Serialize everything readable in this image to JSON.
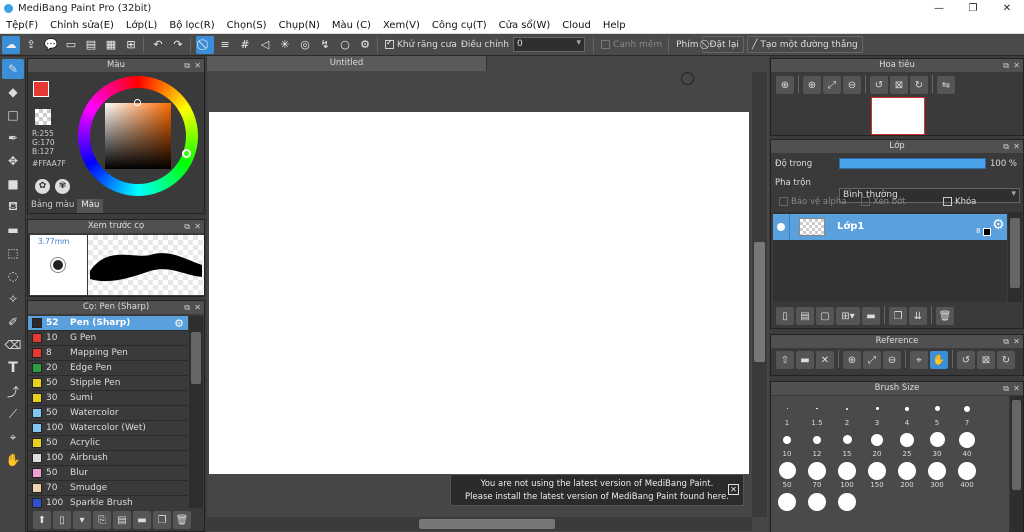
{
  "app": {
    "title": "MediBang Paint Pro (32bit)",
    "minimize": "—",
    "maximize": "❐",
    "close": "✕"
  },
  "menu": [
    "Tệp(F)",
    "Chỉnh sửa(E)",
    "Lớp(L)",
    "Bộ lọc(R)",
    "Chọn(S)",
    "Chụp(N)",
    "Màu (C)",
    "Xem(V)",
    "Công cụ(T)",
    "Cửa sổ(W)",
    "Cloud",
    "Help"
  ],
  "toolbar": {
    "antialias_label": "Khử răng cưa",
    "adjust_label": "Điều chỉnh",
    "adjust_value": "0",
    "edge_label": "Cạnh mềm",
    "keys_label": "Phím",
    "reset_label": "Đặt lại",
    "straight_line_label": "Tạo một đường thẳng"
  },
  "color_panel": {
    "title": "Màu",
    "r": "R:255",
    "g": "G:170",
    "b": "B:127",
    "hex": "#FFAA7F",
    "tab_palette": "Bảng màu",
    "tab_color": "Màu",
    "primary_color": "#FFAA7F",
    "accent_red": "#e53935"
  },
  "brush_preview": {
    "title": "Xem trước cọ",
    "size": "3.77mm"
  },
  "brush_panel": {
    "title": "Cọ: Pen (Sharp)",
    "items": [
      {
        "size": "52",
        "name": "Pen (Sharp)",
        "color": "#2a2a2a"
      },
      {
        "size": "10",
        "name": "G Pen",
        "color": "#e53935"
      },
      {
        "size": "8",
        "name": "Mapping Pen",
        "color": "#e53935"
      },
      {
        "size": "20",
        "name": "Edge Pen",
        "color": "#2e9e3e"
      },
      {
        "size": "50",
        "name": "Stipple Pen",
        "color": "#e8d020"
      },
      {
        "size": "30",
        "name": "Sumi",
        "color": "#e8d020"
      },
      {
        "size": "50",
        "name": "Watercolor",
        "color": "#7ec8f0"
      },
      {
        "size": "100",
        "name": "Watercolor (Wet)",
        "color": "#7ec8f0"
      },
      {
        "size": "50",
        "name": "Acrylic",
        "color": "#e8d020"
      },
      {
        "size": "100",
        "name": "Airbrush",
        "color": "#dddddd"
      },
      {
        "size": "50",
        "name": "Blur",
        "color": "#f0a0d0"
      },
      {
        "size": "70",
        "name": "Smudge",
        "color": "#f0d0b0"
      },
      {
        "size": "100",
        "name": "Sparkle Brush",
        "color": "#3050d0"
      }
    ]
  },
  "canvas": {
    "tab": "Untitled"
  },
  "notice": {
    "line1": "You are not using the latest version of MediBang Paint.",
    "line2": "Please install the latest version of MediBang Paint found here."
  },
  "navigator": {
    "title": "Hoa tiêu"
  },
  "layer_panel": {
    "title": "Lớp",
    "opacity_label": "Độ trong",
    "opacity_value": "100 %",
    "blend_label": "Pha trộn",
    "blend_value": "Bình thường",
    "protect_alpha": "Bảo vệ alpha",
    "clipping": "Xén bớt",
    "lock": "Khóa",
    "layer_name": "Lớp1",
    "layer_bits": "8"
  },
  "reference": {
    "title": "Reference"
  },
  "brush_size": {
    "title": "Brush Size",
    "sizes": [
      "1",
      "1.5",
      "2",
      "3",
      "4",
      "5",
      "7",
      "10",
      "12",
      "15",
      "20",
      "25",
      "30",
      "40",
      "50",
      "70",
      "100",
      "150",
      "200",
      "300",
      "400",
      "",
      "",
      ""
    ]
  }
}
